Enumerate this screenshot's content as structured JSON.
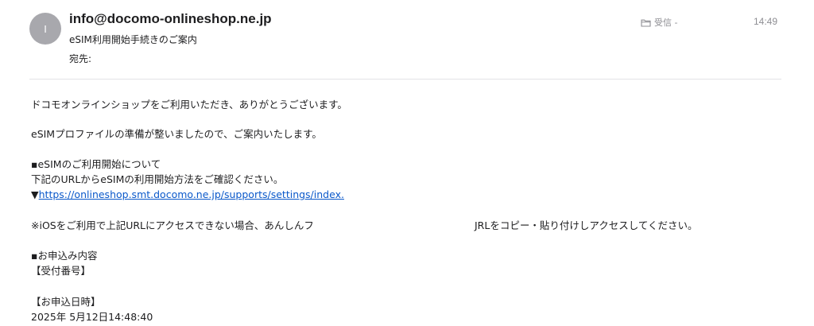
{
  "header": {
    "avatar_initial": "I",
    "sender": "info@docomo-onlineshop.ne.jp",
    "subject": "eSIM利用開始手続きのご案内",
    "to_label": "宛先:",
    "folder": "受信 -",
    "folder_icon": "folder-icon",
    "time": "14:49"
  },
  "body": {
    "greeting": "ドコモオンラインショップをご利用いただき、ありがとうございます。",
    "profile_ready": "eSIMプロファイルの準備が整いましたので、ご案内いたします。",
    "section_start": "▪eSIMのご利用開始について",
    "instructions": "下記のURLからeSIMの利用開始方法をご確認ください。",
    "link_marker": "▼",
    "link_text": "https://onlineshop.smt.docomo.ne.jp/supports/settings/index.",
    "ios_note_part1": "※iOSをご利用で上記URLにアクセスできない場合、あんしんフ",
    "ios_note_part2": "JRLをコピー・貼り付けしアクセスしてください。",
    "section_order": "▪お申込み内容",
    "receipt_label": "【受付番号】",
    "order_date_label": "【お申込日時】",
    "order_date_value": "2025年 5月12日14:48:40"
  }
}
